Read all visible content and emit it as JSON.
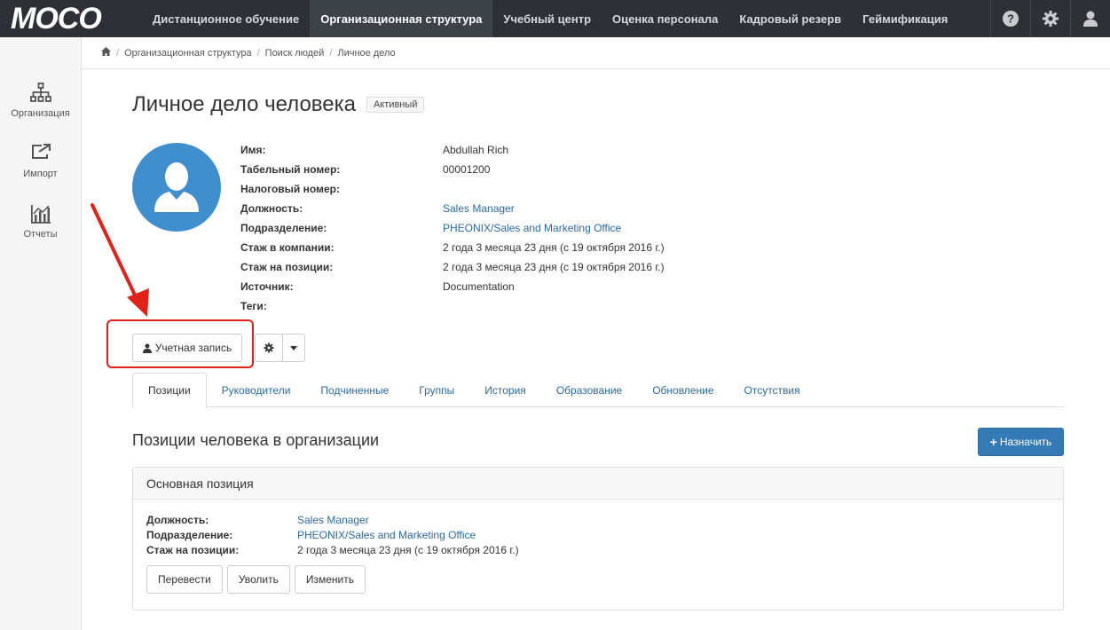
{
  "app": {
    "logo": "MOCO"
  },
  "navbar": {
    "items": [
      {
        "label": "Дистанционное обучение"
      },
      {
        "label": "Организационная структура"
      },
      {
        "label": "Учебный центр"
      },
      {
        "label": "Оценка персонала"
      },
      {
        "label": "Кадровый резерв"
      },
      {
        "label": "Геймификация"
      }
    ],
    "active_index": 1,
    "right_icons": [
      "question-circle-icon",
      "gear-icon",
      "user-icon"
    ]
  },
  "sidebar": {
    "items": [
      {
        "label": "Организация",
        "icon": "org-chart-icon"
      },
      {
        "label": "Импорт",
        "icon": "import-icon"
      },
      {
        "label": "Отчеты",
        "icon": "report-chart-icon"
      }
    ]
  },
  "breadcrumb": {
    "home_icon": "home-icon",
    "items": [
      "Организационная структура",
      "Поиск людей",
      "Личное дело"
    ]
  },
  "page": {
    "title": "Личное дело человека",
    "status": "Активный"
  },
  "profile": {
    "rows": [
      {
        "label": "Имя:",
        "value": "Abdullah Rich"
      },
      {
        "label": "Табельный номер:",
        "value": "00001200"
      },
      {
        "label": "Налоговый номер:",
        "value": ""
      },
      {
        "label": "Должность:",
        "value": "Sales Manager"
      },
      {
        "label": "Подразделение:",
        "value": "PHEONIX/Sales and Marketing Office"
      },
      {
        "label": "Стаж в компании:",
        "value": "2 года 3 месяца 23 дня (с 19 октября 2016 г.)"
      },
      {
        "label": "Стаж на позиции:",
        "value": "2 года 3 месяца 23 дня (с 19 октября 2016 г.)"
      },
      {
        "label": "Источник:",
        "value": "Documentation"
      },
      {
        "label": "Теги:",
        "value": ""
      }
    ]
  },
  "actions": {
    "account_label": "Учетная запись"
  },
  "tabs": [
    {
      "label": "Позиции"
    },
    {
      "label": "Руководители"
    },
    {
      "label": "Подчиненные"
    },
    {
      "label": "Группы"
    },
    {
      "label": "История"
    },
    {
      "label": "Образование"
    },
    {
      "label": "Обновление"
    },
    {
      "label": "Отсутствия"
    }
  ],
  "section": {
    "title": "Позиции человека в организации",
    "assign_label": "Назначить"
  },
  "panel": {
    "heading": "Основная позиция",
    "rows": [
      {
        "label": "Должность:",
        "value": "Sales Manager"
      },
      {
        "label": "Подразделение:",
        "value": "PHEONIX/Sales and Marketing Office"
      },
      {
        "label": "Стаж на позиции:",
        "value": "2 года 3 месяца 23 дня (с 19 октября 2016 г.)"
      }
    ],
    "buttons": [
      {
        "label": "Перевести"
      },
      {
        "label": "Уволить"
      },
      {
        "label": "Изменить"
      }
    ]
  },
  "colors": {
    "navbar_bg": "#2d3035",
    "accent": "#337ab7",
    "link": "#2a6aa8",
    "avatar_bg": "#3f8fcf",
    "annotation": "#e0221b"
  }
}
